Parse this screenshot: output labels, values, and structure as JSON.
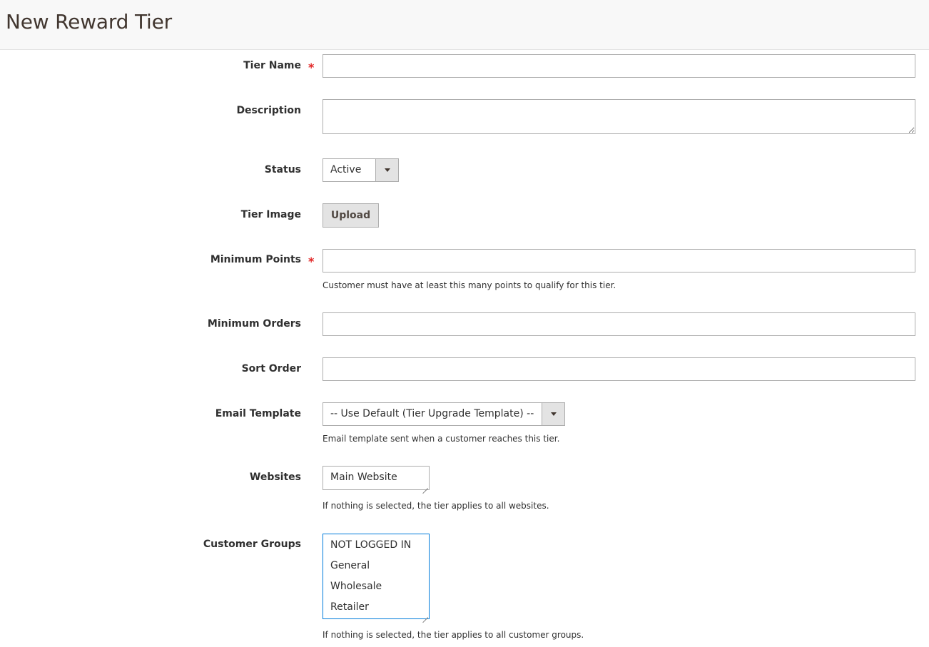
{
  "header": {
    "title": "New Reward Tier"
  },
  "form": {
    "tier_name": {
      "label": "Tier Name",
      "required": "*",
      "value": ""
    },
    "description": {
      "label": "Description",
      "value": ""
    },
    "status": {
      "label": "Status",
      "selected": "Active"
    },
    "tier_image": {
      "label": "Tier Image",
      "button_label": "Upload"
    },
    "minimum_points": {
      "label": "Minimum Points",
      "required": "*",
      "value": "",
      "note": "Customer must have at least this many points to qualify for this tier."
    },
    "minimum_orders": {
      "label": "Minimum Orders",
      "value": ""
    },
    "sort_order": {
      "label": "Sort Order",
      "value": ""
    },
    "email_template": {
      "label": "Email Template",
      "selected": "-- Use Default (Tier Upgrade Template) --",
      "note": "Email template sent when a customer reaches this tier."
    },
    "websites": {
      "label": "Websites",
      "options": [
        "Main Website"
      ],
      "note": "If nothing is selected, the tier applies to all websites."
    },
    "customer_groups": {
      "label": "Customer Groups",
      "options": [
        "NOT LOGGED IN",
        "General",
        "Wholesale",
        "Retailer"
      ],
      "note": "If nothing is selected, the tier applies to all customer groups."
    }
  },
  "colors": {
    "required": "#e22626",
    "focus_border": "#007bdb",
    "header_bg": "#f8f8f8",
    "button_bg": "#e3e3e3"
  },
  "icons": {
    "select_arrow": "chevron-down-icon",
    "resize": "resize-handle-icon"
  }
}
